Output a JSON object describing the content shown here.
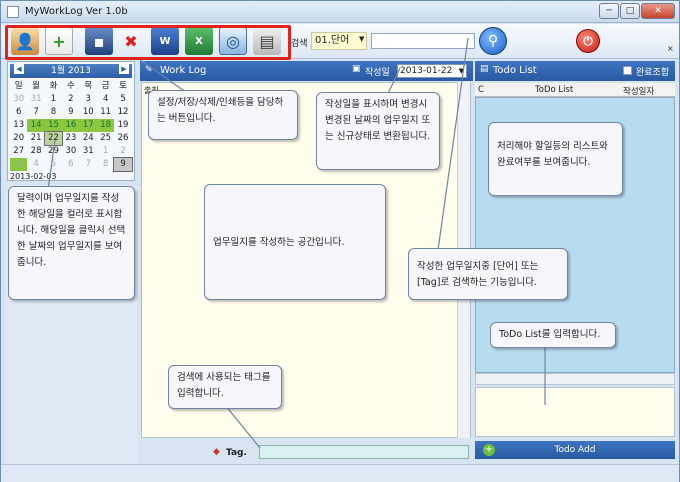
{
  "window": {
    "title": "MyWorkLog Ver 1.0b",
    "min": "─",
    "max": "□",
    "close": "✕"
  },
  "toolbar": {
    "search_label": "검색",
    "search_type": "01.단어",
    "search_value": "",
    "corner": "×"
  },
  "calendar": {
    "month_label": "1월 2013",
    "prev": "◀",
    "next": "▶",
    "weekdays": [
      "일",
      "월",
      "화",
      "수",
      "목",
      "금",
      "토"
    ],
    "weeks": [
      [
        "30",
        "31",
        "1",
        "2",
        "3",
        "4",
        "5"
      ],
      [
        "6",
        "7",
        "8",
        "9",
        "10",
        "11",
        "12"
      ],
      [
        "13",
        "14",
        "15",
        "16",
        "17",
        "18",
        "19"
      ],
      [
        "20",
        "21",
        "22",
        "23",
        "24",
        "25",
        "26"
      ],
      [
        "27",
        "28",
        "29",
        "30",
        "31",
        "1",
        "2"
      ],
      [
        "3",
        "4",
        "5",
        "6",
        "7",
        "8",
        "9"
      ]
    ],
    "selected_date": "2013-02-03"
  },
  "worklog": {
    "title": "Work Log",
    "date_label": "작성일",
    "date_value": "2013-01-22",
    "editor_prefix": "출칭",
    "tag_label": "Tag."
  },
  "todo": {
    "title": "Todo List",
    "done_label": "완료조합",
    "columns": [
      "C",
      "ToDo List",
      "작성일자"
    ],
    "add_label": "Todo Add"
  },
  "callouts": {
    "toolbar_help": "설정/저장/삭제/인쇄등을 담당하는 버튼입니다.",
    "date_help": "작성일을 표시하며 변경시 변경된 날짜의 업무일지 또는 신규상태로 변환됩니다.",
    "calendar_help": "달력이며 업무일지를 작성한 해당일을 컬러로 표시합니다. 해당일을 클릭시 선택한 날짜의 업무일지를 보여줍니다.",
    "editor_help": "업무일지를 작성하는 공간입니다.",
    "todo_list_help": "처리해야 할일등의 리스트와 완료여부를 보여줍니다.",
    "search_help": "작성한 업무일지중 [단어] 또는 [Tag]로 검색하는 기능입니다.",
    "tag_help": "검색에 사용되는 태그를 입력합니다.",
    "todo_input_help": "ToDo List를 입력합니다."
  }
}
